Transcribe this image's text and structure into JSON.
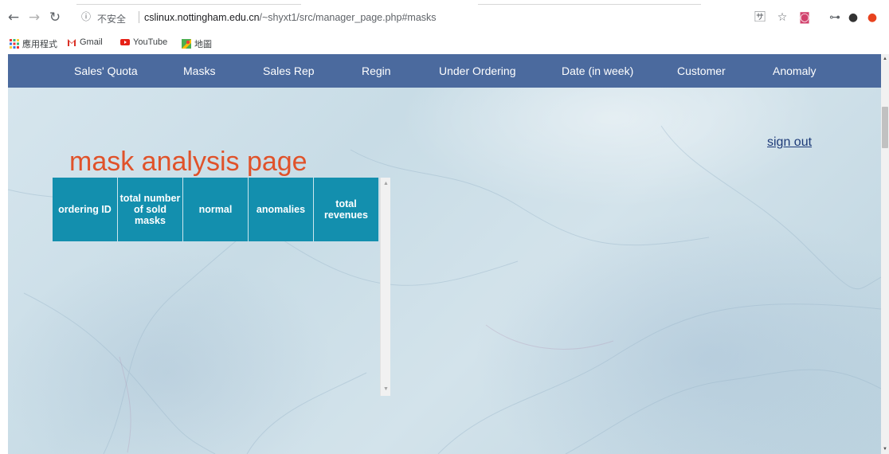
{
  "browser": {
    "security_label": "不安全",
    "url_host": "cslinux.nottingham.edu.cn",
    "url_path": "/~shyxt1/src/manager_page.php#masks",
    "bookmarks": [
      {
        "label": "應用程式",
        "icon": "apps-grid-icon"
      },
      {
        "label": "Gmail",
        "icon": "gmail-icon"
      },
      {
        "label": "YouTube",
        "icon": "youtube-icon"
      },
      {
        "label": "地圖",
        "icon": "maps-icon"
      }
    ]
  },
  "nav": {
    "items": [
      {
        "label": "Sales' Quota"
      },
      {
        "label": "Masks"
      },
      {
        "label": "Sales Rep"
      },
      {
        "label": "Regin"
      },
      {
        "label": "Under Ordering"
      },
      {
        "label": "Date (in week)"
      },
      {
        "label": "Customer"
      },
      {
        "label": "Anomaly"
      }
    ],
    "background": "#4b6a9e"
  },
  "page": {
    "title": "mask analysis page",
    "title_color": "#e0522a",
    "sign_out": "sign out"
  },
  "table": {
    "columns": [
      "ordering ID",
      "total number of sold masks",
      "normal",
      "anomalies",
      "total revenues"
    ],
    "header_color": "#138fae",
    "rows": []
  }
}
